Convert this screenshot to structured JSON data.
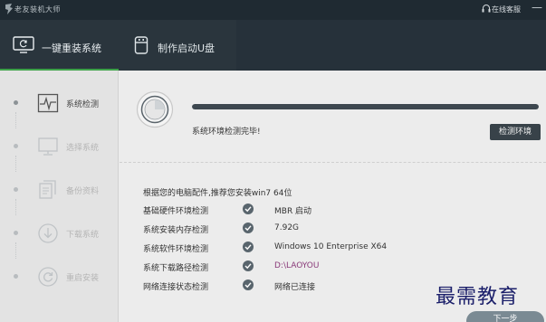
{
  "titlebar": {
    "app_title": "老友装机大师",
    "service_label": "在线客服",
    "minimize_glyph": "—"
  },
  "tabs": [
    {
      "label": "一键重装系统",
      "icon": "monitor-refresh-icon",
      "active": true
    },
    {
      "label": "制作启动U盘",
      "icon": "usb-drive-icon",
      "active": false
    }
  ],
  "steps": [
    {
      "label": "系统检测",
      "icon": "heartbeat-monitor-icon",
      "active": true
    },
    {
      "label": "选择系统",
      "icon": "monitor-icon",
      "active": false
    },
    {
      "label": "备份资料",
      "icon": "documents-icon",
      "active": false
    },
    {
      "label": "下载系统",
      "icon": "download-icon",
      "active": false
    },
    {
      "label": "重启安装",
      "icon": "restart-icon",
      "active": false
    }
  ],
  "detection": {
    "progress_fraction": 1.0,
    "status_text": "系统环境检测完毕!",
    "detect_button": "检测环境",
    "recommendation": "根据您的电脑配件,推荐您安装win7 64位",
    "rows": [
      {
        "label": "基础硬件环境检测",
        "value": "MBR 启动"
      },
      {
        "label": "系统安装内存检测",
        "value": "7.92G"
      },
      {
        "label": "系统软件环境检测",
        "value": "Windows 10 Enterprise X64"
      },
      {
        "label": "系统下载路径检测",
        "value": "D:\\LAOYOU"
      },
      {
        "label": "网络连接状态检测",
        "value": "网络已连接"
      }
    ],
    "next_button": "下一步"
  },
  "watermark": "最需教育",
  "colors": {
    "titlebar_bg": "#1f2a32",
    "tabbar_bg": "#2a353d",
    "active_underline": "#3ea24a",
    "button_bg": "#384249",
    "path_value": "#8a3b7a"
  }
}
